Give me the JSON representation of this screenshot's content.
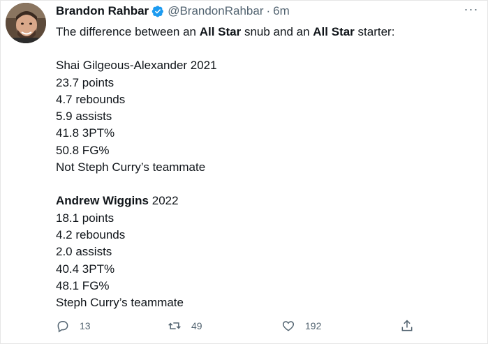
{
  "author": {
    "name": "Brandon Rahbar",
    "handle": "@BrandonRahbar",
    "separator": "·",
    "time": "6m"
  },
  "tweet": {
    "intro": [
      "The difference between an ",
      "All Star",
      " snub and an ",
      "All Star",
      " starter:"
    ],
    "player1": {
      "name": "Shai Gilgeous-Alexander 2021",
      "stats": [
        "23.7 points",
        "4.7 rebounds",
        "5.9 assists",
        "41.8 3PT%",
        "50.8 FG%",
        "Not Steph Curry’s teammate"
      ]
    },
    "player2": {
      "name_bold": "Andrew Wiggins",
      "year": " 2022",
      "stats": [
        "18.1 points",
        "4.2 rebounds",
        "2.0 assists",
        "40.4 3PT%",
        "48.1 FG%",
        "Steph Curry’s teammate"
      ]
    }
  },
  "actions": {
    "replies": "13",
    "retweets": "49",
    "likes": "192"
  },
  "more_label": "···",
  "colors": {
    "verified": "#1d9bf0",
    "muted": "#536471",
    "text": "#0f1419"
  }
}
